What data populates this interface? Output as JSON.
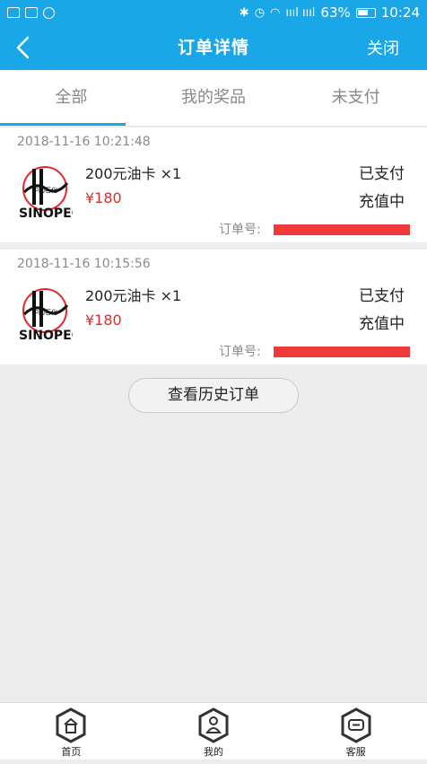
{
  "status_bar": {
    "battery": "63%",
    "time": "10:24",
    "signal_text": "ıııl ıııl"
  },
  "nav": {
    "title": "订单详情",
    "close_label": "关闭"
  },
  "tabs": [
    {
      "label": "全部",
      "active": true
    },
    {
      "label": "我的奖品",
      "active": false
    },
    {
      "label": "未支付",
      "active": false
    }
  ],
  "orders": [
    {
      "date": "2018-11-16 10:21:48",
      "name": "200元油卡 ×1",
      "price": "¥180",
      "status": "已支付",
      "sub_status": "充值中",
      "order_no_label": "订单号:"
    },
    {
      "date": "2018-11-16 10:15:56",
      "name": "200元油卡 ×1",
      "price": "¥180",
      "status": "已支付",
      "sub_status": "充值中",
      "order_no_label": "订单号:"
    }
  ],
  "history_button": "查看历史订单",
  "bottom_nav": [
    {
      "label": "首页",
      "icon": "home-icon"
    },
    {
      "label": "我的",
      "icon": "user-icon"
    },
    {
      "label": "客服",
      "icon": "chat-icon"
    }
  ],
  "colors": {
    "accent": "#1aa7e8",
    "price": "#e8262a",
    "redaction": "#f03a3a"
  }
}
